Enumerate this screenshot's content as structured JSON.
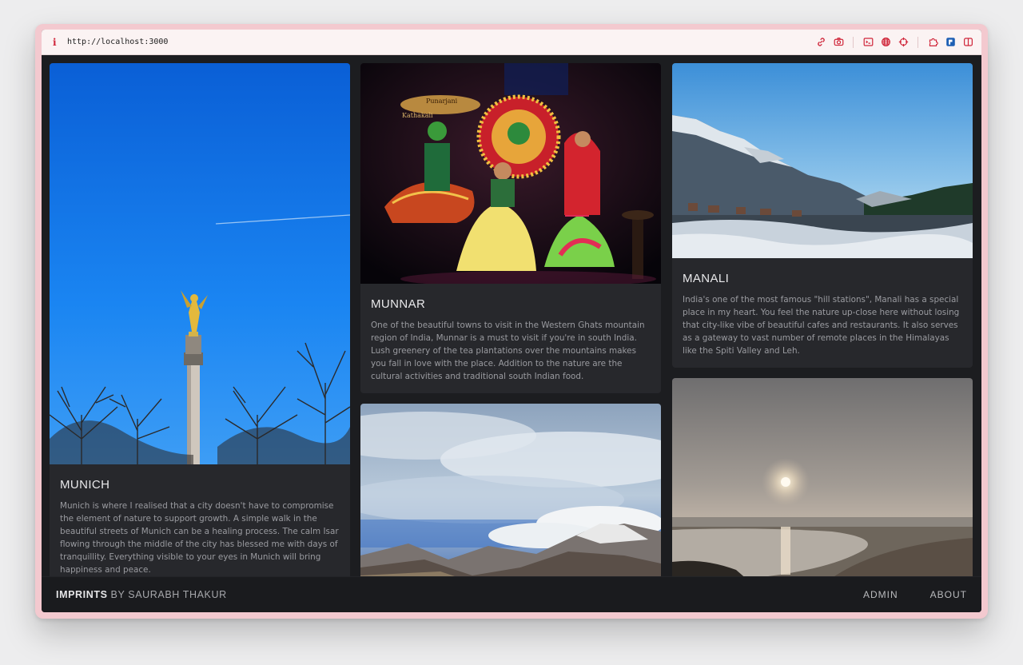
{
  "browser": {
    "url": "http://localhost:3000",
    "info_glyph": "i",
    "tools": [
      "link-icon",
      "camera-icon",
      "terminal-icon",
      "globe-icon",
      "crosshair-icon",
      "extension-icon",
      "shield-icon",
      "sidebar-icon"
    ]
  },
  "cards": [
    {
      "title": "MUNICH",
      "text": "Munich is where I realised that a city doesn't have to compromise the element of nature to support growth. A simple walk in the beautiful streets of Munich can be a healing process. The calm Isar flowing through the middle of the city has blessed me with days of tranquillity. Everything visible to your eyes in Munich will bring happiness and peace.",
      "image": "angel-column-blue-sky-photo"
    },
    {
      "title": "MUNNAR",
      "text": "One of the beautiful towns to visit in the Western Ghats mountain region of India, Munnar is a must to visit if you're in south India. Lush greenery of the tea plantations over the mountains makes you fall in love with the place. Addition to the nature are the cultural activities and traditional south Indian food.",
      "image": "kathakali-dancers-photo",
      "sign_text": [
        "Punarjani",
        "Kathakali"
      ]
    },
    {
      "title": "",
      "text": "",
      "image": "cloudy-mountains-photo"
    },
    {
      "title": "MANALI",
      "text": "India's one of the most famous \"hill stations\", Manali has a special place in my heart. You feel the nature up-close here without losing that city-like vibe of beautiful cafes and restaurants. It also serves as a gateway to vast number of remote places in the Himalayas like the Spiti Valley and Leh.",
      "image": "snowy-valley-photo"
    },
    {
      "title": "",
      "text": "",
      "image": "beach-sunset-photo"
    }
  ],
  "footer": {
    "brand": "IMPRINTS",
    "by": "BY SAURABH THAKUR",
    "nav": [
      "ADMIN",
      "ABOUT"
    ]
  },
  "colors": {
    "page_bg": "#1c1d20",
    "card_bg": "#27282c",
    "window_frame": "#f3c9cf",
    "accent_red": "#d0263a"
  }
}
